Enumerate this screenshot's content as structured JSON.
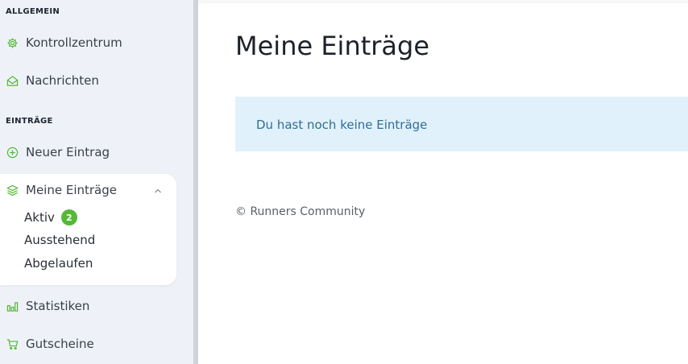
{
  "sidebar": {
    "sections": [
      {
        "title": "ALLGEMEIN"
      },
      {
        "title": "EINTRÄGE"
      }
    ],
    "items": [
      {
        "label": "Kontrollzentrum",
        "icon": "gear-icon"
      },
      {
        "label": "Nachrichten",
        "icon": "envelope-open-icon"
      },
      {
        "label": "Neuer Eintrag",
        "icon": "plus-circle-icon"
      },
      {
        "label": "Meine Einträge",
        "icon": "layers-icon"
      },
      {
        "label": "Statistiken",
        "icon": "bar-chart-icon"
      },
      {
        "label": "Gutscheine",
        "icon": "cart-icon"
      }
    ],
    "sub_items": [
      {
        "label": "Aktiv",
        "badge": "2"
      },
      {
        "label": "Ausstehend"
      },
      {
        "label": "Abgelaufen"
      }
    ]
  },
  "main": {
    "title": "Meine Einträge",
    "notice": "Du hast noch keine Einträge",
    "footer": "© Runners Community"
  },
  "colors": {
    "accent": "#55b837",
    "notice_bg": "#e1f1fb",
    "notice_text": "#2e6f95",
    "sidebar_bg": "#eef2f8"
  }
}
